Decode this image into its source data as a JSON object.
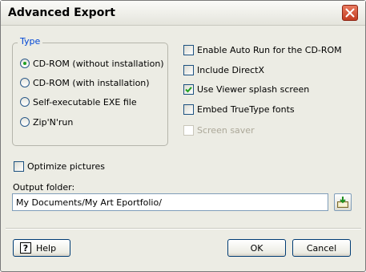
{
  "window": {
    "title": "Advanced Export",
    "close_icon": "close-icon"
  },
  "type_group": {
    "legend": "Type",
    "options": [
      {
        "label": "CD-ROM (without installation)",
        "checked": true
      },
      {
        "label": "CD-ROM (with installation)",
        "checked": false
      },
      {
        "label": "Self-executable EXE file",
        "checked": false
      },
      {
        "label": "Zip'N'run",
        "checked": false
      }
    ]
  },
  "options": [
    {
      "label": "Enable Auto Run for the CD-ROM",
      "checked": false,
      "enabled": true
    },
    {
      "label": "Include DirectX",
      "checked": false,
      "enabled": true
    },
    {
      "label": "Use Viewer splash screen",
      "checked": true,
      "enabled": true
    },
    {
      "label": "Embed TrueType fonts",
      "checked": false,
      "enabled": true
    },
    {
      "label": "Screen saver",
      "checked": false,
      "enabled": false
    }
  ],
  "optimize": {
    "label": "Optimize pictures",
    "checked": false
  },
  "output": {
    "label": "Output folder:",
    "value": "My Documents/My Art Eportfolio/",
    "browse_icon": "browse-folder-icon"
  },
  "buttons": {
    "help": "Help",
    "ok": "OK",
    "cancel": "Cancel"
  },
  "colors": {
    "accent": "#0046d5",
    "checked_radio": "#21a121",
    "checkmark": "#21a121",
    "close_button": "#c33c20"
  }
}
